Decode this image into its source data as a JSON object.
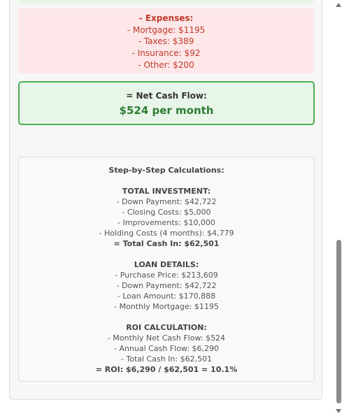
{
  "expenses": {
    "title": "- Expenses:",
    "items": [
      "- Mortgage: $1195",
      "- Taxes: $389",
      "- Insurance: $92",
      "- Other: $200"
    ]
  },
  "net_cash_flow": {
    "label": "= Net Cash Flow:",
    "value": "$524 per month"
  },
  "calculations": {
    "title": "Step-by-Step Calculations:",
    "investment": {
      "heading": "TOTAL INVESTMENT:",
      "lines": [
        "- Down Payment: $42,722",
        "- Closing Costs: $5,000",
        "- Improvements: $10,000",
        "- Holding Costs (4 months): $4,779"
      ],
      "total": "= Total Cash In: $62,501"
    },
    "loan": {
      "heading": "LOAN DETAILS:",
      "lines": [
        "- Purchase Price: $213,609",
        "- Down Payment: $42,722",
        "- Loan Amount: $170,888",
        "- Monthly Mortgage: $1195"
      ]
    },
    "roi": {
      "heading": "ROI CALCULATION:",
      "lines": [
        "- Monthly Net Cash Flow: $524",
        "- Annual Cash Flow: $6,290",
        "- Total Cash In: $62,501"
      ],
      "result": "= ROI: $6,290 / $62,501 = 10.1%"
    }
  },
  "colors": {
    "expense_bg": "#fde7e8",
    "expense_text": "#c0392b",
    "net_bg": "#e8f5e9",
    "net_border": "#4caf50",
    "net_value": "#2e7d32"
  }
}
